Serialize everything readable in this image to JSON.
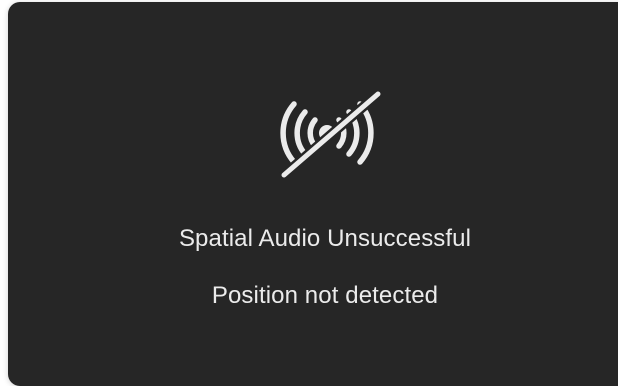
{
  "dialog": {
    "title": "Spatial Audio Unsuccessful",
    "subtitle": "Position not detected",
    "icon": "spatial-audio-off-icon",
    "colors": {
      "background": "#262626",
      "text": "#ebebeb",
      "icon": "#ebebeb"
    }
  }
}
